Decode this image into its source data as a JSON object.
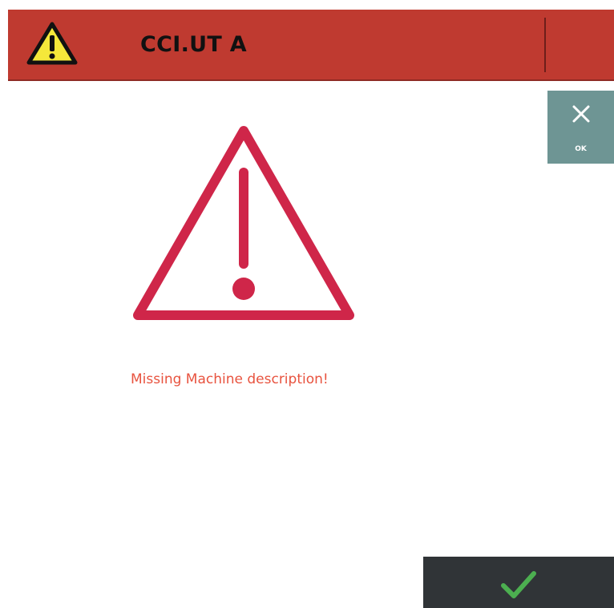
{
  "header": {
    "title": "CCI.UT A",
    "icon": "warning-triangle-icon",
    "background_color": "#bf3a30"
  },
  "ok_button": {
    "label": "OK",
    "icon": "close-icon",
    "background_color": "#6e9594"
  },
  "dialog": {
    "icon": "warning-triangle-icon",
    "icon_color": "#cf2649",
    "message": "Missing Machine description!",
    "message_color": "#e8533f"
  },
  "confirm_button": {
    "icon": "check-icon",
    "icon_color": "#4caf50",
    "background_color": "#303437"
  }
}
